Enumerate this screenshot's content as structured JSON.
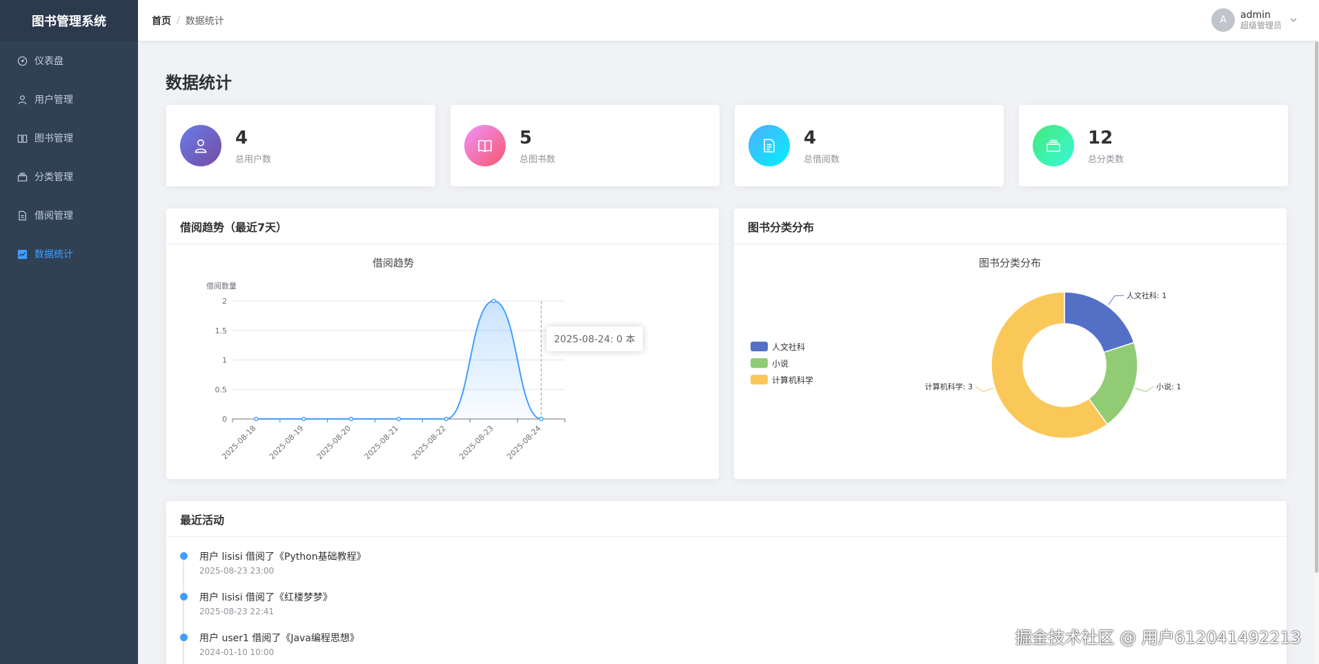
{
  "app": {
    "title": "图书管理系统"
  },
  "sidebar": {
    "items": [
      {
        "label": "仪表盘",
        "icon": "dashboard-icon",
        "active": false
      },
      {
        "label": "用户管理",
        "icon": "user-icon",
        "active": false
      },
      {
        "label": "图书管理",
        "icon": "book-icon",
        "active": false
      },
      {
        "label": "分类管理",
        "icon": "category-icon",
        "active": false
      },
      {
        "label": "借阅管理",
        "icon": "document-icon",
        "active": false
      },
      {
        "label": "数据统计",
        "icon": "chart-icon",
        "active": true
      }
    ]
  },
  "header": {
    "breadcrumb": {
      "home": "首页",
      "separator": "/",
      "current": "数据统计"
    },
    "user": {
      "avatar_letter": "A",
      "name": "admin",
      "role": "超级管理员"
    }
  },
  "page": {
    "title": "数据统计"
  },
  "stats": [
    {
      "value": "4",
      "label": "总用户数",
      "icon": "user-icon",
      "color_from": "#667eea",
      "color_to": "#764ba2"
    },
    {
      "value": "5",
      "label": "总图书数",
      "icon": "book-icon",
      "color_from": "#f093fb",
      "color_to": "#f5576c"
    },
    {
      "value": "4",
      "label": "总借阅数",
      "icon": "document-icon",
      "color_from": "#4facfe",
      "color_to": "#00f2fe"
    },
    {
      "value": "12",
      "label": "总分类数",
      "icon": "category-icon",
      "color_from": "#43e97b",
      "color_to": "#38f9d7"
    }
  ],
  "trend_panel": {
    "title": "借阅趋势（最近7天）"
  },
  "pie_panel": {
    "title": "图书分类分布"
  },
  "activity_panel": {
    "title": "最近活动",
    "items": [
      {
        "text": "用户 lisisi 借阅了《Python基础教程》",
        "time": "2025-08-23 23:00"
      },
      {
        "text": "用户 lisisi 借阅了《红楼梦梦》",
        "time": "2025-08-23 22:41"
      },
      {
        "text": "用户 user1 借阅了《Java编程思想》",
        "time": "2024-01-10 10:00"
      }
    ]
  },
  "tooltip": {
    "text": "2025-08-24: 0 本"
  },
  "watermark": "掘金技术社区 @ 用户612041492213",
  "colors": {
    "accent": "#409eff",
    "sidebar_bg": "#304156",
    "line": "#409eff"
  },
  "chart_data": [
    {
      "type": "line",
      "title": "借阅趋势",
      "ylabel": "借阅数量",
      "xlabel": "",
      "categories": [
        "2025-08-18",
        "2025-08-19",
        "2025-08-20",
        "2025-08-21",
        "2025-08-22",
        "2025-08-23",
        "2025-08-24"
      ],
      "values": [
        0,
        0,
        0,
        0,
        0,
        2,
        0
      ],
      "ylim": [
        0,
        2
      ],
      "yticks": [
        "0",
        "0.5",
        "1",
        "1.5",
        "2"
      ],
      "smooth": true,
      "area": true,
      "grid": true
    },
    {
      "type": "pie",
      "title": "图书分类分布",
      "donut": true,
      "legend": "left",
      "slices": [
        {
          "name": "人文社科",
          "value": 1,
          "label": "人文社科: 1",
          "color": "#5470c6"
        },
        {
          "name": "小说",
          "value": 1,
          "label": "小说: 1",
          "color": "#91cc75"
        },
        {
          "name": "计算机科学",
          "value": 3,
          "label": "计算机科学: 3",
          "color": "#fac858"
        }
      ]
    }
  ]
}
